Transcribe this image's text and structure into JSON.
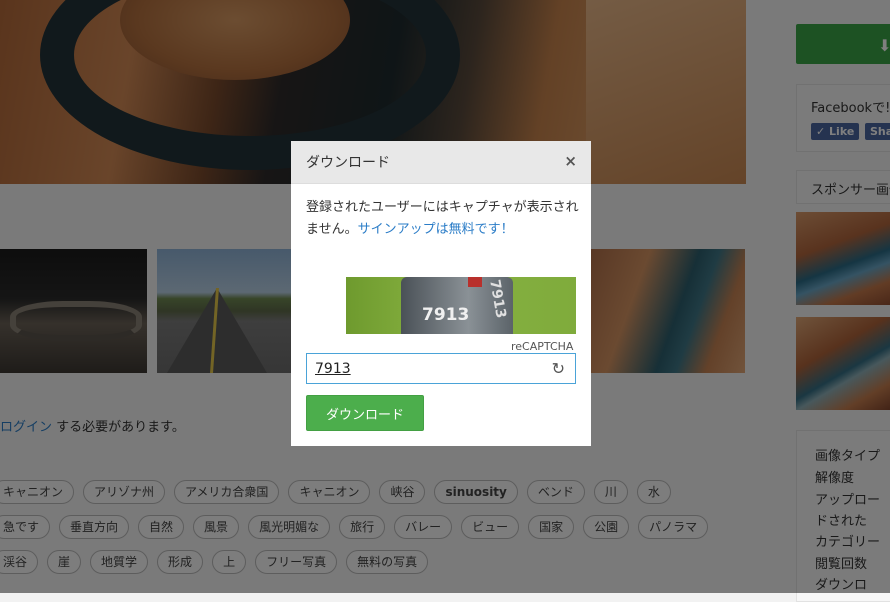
{
  "content": {
    "login_link": "ログイン",
    "login_suffix": " する必要があります。",
    "tags": [
      [
        "キャニオン",
        "アリゾナ州",
        "アメリカ合衆国",
        "キャニオン",
        "峡谷",
        "sinuosity",
        "ベンド",
        "川",
        "水"
      ],
      [
        "急です",
        "垂直方向",
        "自然",
        "風景",
        "風光明媚な",
        "旅行",
        "バレー",
        "ビュー",
        "国家",
        "公園",
        "パノラマ"
      ],
      [
        "渓谷",
        "崖",
        "地質学",
        "形成",
        "上",
        "フリー写真",
        "無料の写真"
      ]
    ]
  },
  "sidebar": {
    "download_icon": "download-arrow-icon",
    "facebook_text": "Facebookで!",
    "fb_like": "Like",
    "fb_share": "Sha",
    "sponsor_label": "スポンサー画像",
    "info_labels": [
      "画像タイプ",
      "解像度",
      "アップロー",
      "ドされた",
      "カテゴリー",
      "閲覧回数",
      "ダウンロ"
    ]
  },
  "modal": {
    "title": "ダウンロード",
    "close": "×",
    "message": "登録されたユーザーにはキャプチャが表示されません。",
    "signup_link": "サインアップは無料です！",
    "captcha_image_text": [
      "7913",
      "7913"
    ],
    "recaptcha_label": "reCAPTCHA",
    "captcha_value": "7913",
    "reload_icon": "↻",
    "download_button": "ダウンロード"
  }
}
